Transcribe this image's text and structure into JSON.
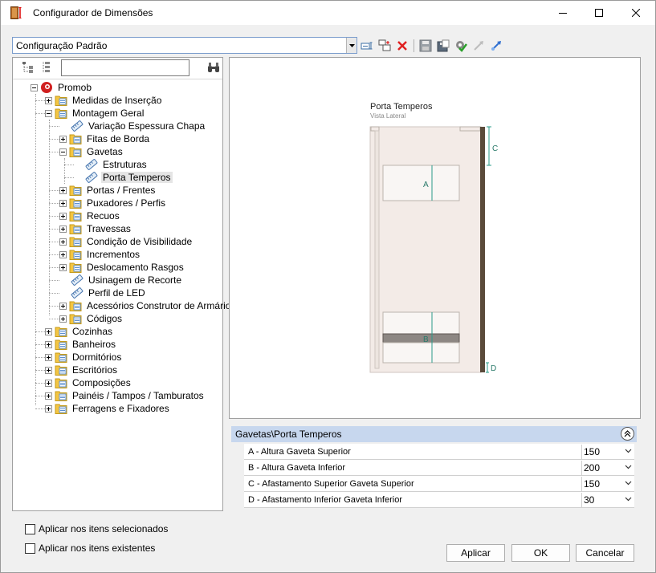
{
  "window": {
    "title": "Configurador de Dimensões"
  },
  "config": {
    "selected": "Configuração Padrão"
  },
  "toolbar": {
    "icons": [
      "new-config-icon",
      "copy-config-icon",
      "delete-icon",
      "save-icon",
      "save-as-icon",
      "apply-check-icon",
      "export-icon",
      "import-icon"
    ]
  },
  "search": {
    "value": "",
    "placeholder": ""
  },
  "tree": {
    "root": "Promob",
    "items": [
      {
        "label": "Medidas de Inserção",
        "level": 1,
        "type": "folder",
        "exp": "plus"
      },
      {
        "label": "Montagem Geral",
        "level": 1,
        "type": "folder",
        "exp": "minus"
      },
      {
        "label": "Variação Espessura Chapa",
        "level": 2,
        "type": "tag",
        "exp": "none"
      },
      {
        "label": "Fitas de Borda",
        "level": 2,
        "type": "folder",
        "exp": "plus"
      },
      {
        "label": "Gavetas",
        "level": 2,
        "type": "folder",
        "exp": "minus"
      },
      {
        "label": "Estruturas",
        "level": 3,
        "type": "tag",
        "exp": "none"
      },
      {
        "label": "Porta Temperos",
        "level": 3,
        "type": "tag",
        "exp": "none",
        "selected": true
      },
      {
        "label": "Portas / Frentes",
        "level": 2,
        "type": "folder",
        "exp": "plus"
      },
      {
        "label": "Puxadores / Perfis",
        "level": 2,
        "type": "folder",
        "exp": "plus"
      },
      {
        "label": "Recuos",
        "level": 2,
        "type": "folder",
        "exp": "plus"
      },
      {
        "label": "Travessas",
        "level": 2,
        "type": "folder",
        "exp": "plus"
      },
      {
        "label": "Condição de Visibilidade",
        "level": 2,
        "type": "folder",
        "exp": "plus"
      },
      {
        "label": "Incrementos",
        "level": 2,
        "type": "folder",
        "exp": "plus"
      },
      {
        "label": "Deslocamento Rasgos",
        "level": 2,
        "type": "folder",
        "exp": "plus"
      },
      {
        "label": "Usinagem de Recorte",
        "level": 2,
        "type": "tag",
        "exp": "none"
      },
      {
        "label": "Perfil de LED",
        "level": 2,
        "type": "tag",
        "exp": "none"
      },
      {
        "label": "Acessórios Construtor de Armários",
        "level": 2,
        "type": "folder",
        "exp": "plus"
      },
      {
        "label": "Códigos",
        "level": 2,
        "type": "folder",
        "exp": "plus"
      },
      {
        "label": "Cozinhas",
        "level": 1,
        "type": "folder",
        "exp": "plus"
      },
      {
        "label": "Banheiros",
        "level": 1,
        "type": "folder",
        "exp": "plus"
      },
      {
        "label": "Dormitórios",
        "level": 1,
        "type": "folder",
        "exp": "plus"
      },
      {
        "label": "Escritórios",
        "level": 1,
        "type": "folder",
        "exp": "plus"
      },
      {
        "label": "Composições",
        "level": 1,
        "type": "folder",
        "exp": "plus"
      },
      {
        "label": "Painéis / Tampos / Tamburatos",
        "level": 1,
        "type": "folder",
        "exp": "plus"
      },
      {
        "label": "Ferragens e Fixadores",
        "level": 1,
        "type": "folder",
        "exp": "plus"
      }
    ]
  },
  "preview": {
    "title": "Porta Temperos",
    "subtitle": "Vista Lateral",
    "labels": {
      "a": "A",
      "b": "B",
      "c": "C",
      "d": "D"
    }
  },
  "props": {
    "header": "Gavetas\\Porta Temperos",
    "rows": [
      {
        "label": "A - Altura Gaveta Superior",
        "value": "150"
      },
      {
        "label": "B - Altura Gaveta Inferior",
        "value": "200"
      },
      {
        "label": "C - Afastamento Superior Gaveta Superior",
        "value": "150"
      },
      {
        "label": "D - Afastamento Inferior Gaveta Inferior",
        "value": "30"
      }
    ]
  },
  "options": {
    "apply_selected": "Aplicar nos itens selecionados",
    "apply_existing": "Aplicar nos itens existentes"
  },
  "buttons": {
    "apply": "Aplicar",
    "ok": "OK",
    "cancel": "Cancelar"
  },
  "colors": {
    "accent": "#c7d7ee",
    "dimension": "#2a9b8a",
    "panel": "#f3ebe7",
    "cabinet_edge": "#5a4a3a"
  }
}
